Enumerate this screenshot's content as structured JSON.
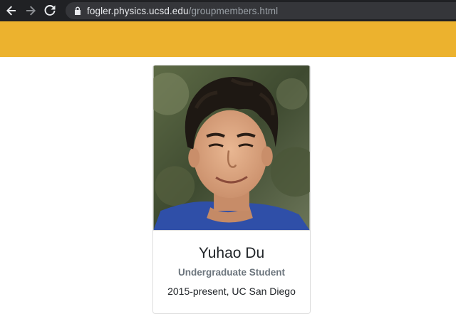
{
  "browser": {
    "url_host": "fogler.physics.ucsd.edu",
    "url_path": "/groupmembers.html",
    "icons": [
      "back-arrow-icon",
      "forward-arrow-icon",
      "reload-icon",
      "lock-icon"
    ]
  },
  "header": {
    "color": "#ecb22e"
  },
  "member": {
    "name": "Yuhao Du",
    "role": "Undergraduate Student",
    "period": "2015-present, UC San Diego"
  }
}
